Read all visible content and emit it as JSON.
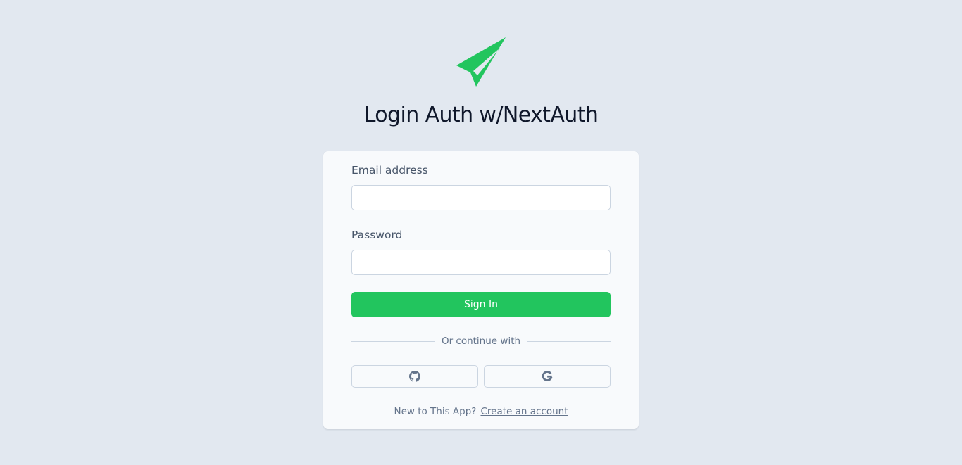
{
  "logo": {
    "icon": "paper-plane-icon",
    "color": "#22c55e"
  },
  "title": "Login Auth w/NextAuth",
  "form": {
    "email_label": "Email address",
    "email_value": "",
    "password_label": "Password",
    "password_value": "",
    "submit_label": "Sign In",
    "divider_text": "Or continue with",
    "social": [
      {
        "icon": "github-icon"
      },
      {
        "icon": "google-icon"
      }
    ],
    "footer_text": "New to This App?",
    "footer_link": "Create an account"
  },
  "colors": {
    "background": "#e2e8f0",
    "card": "#f8fafc",
    "accent": "#22c55e",
    "title": "#0f172a",
    "muted": "#64748b"
  }
}
